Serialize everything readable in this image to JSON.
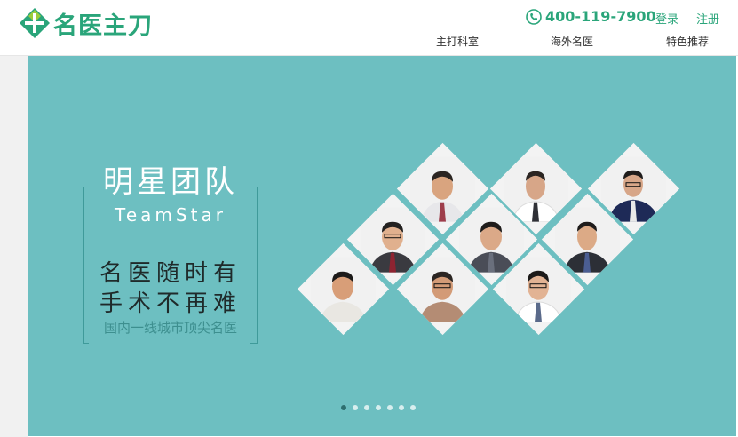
{
  "header": {
    "logo_text": "名医主刀",
    "phone": "400-119-7900",
    "login_label": "登录",
    "register_label": "注册",
    "nav": [
      "主打科室",
      "海外名医",
      "特色推荐"
    ]
  },
  "banner": {
    "title": "明星团队",
    "subtitle_en": "TeamStar",
    "line1": "名医随时有",
    "line2": "手术不再难",
    "tagline": "国内一线城市顶尖名医",
    "carousel_dots": 7,
    "active_dot": 0
  },
  "colors": {
    "brand": "#2aa57a",
    "banner_bg": "#6dbfc1",
    "frame": "#3f9a9a",
    "tile_bg": "#f3f3f3"
  },
  "icons": {
    "phone": "phone-icon"
  }
}
